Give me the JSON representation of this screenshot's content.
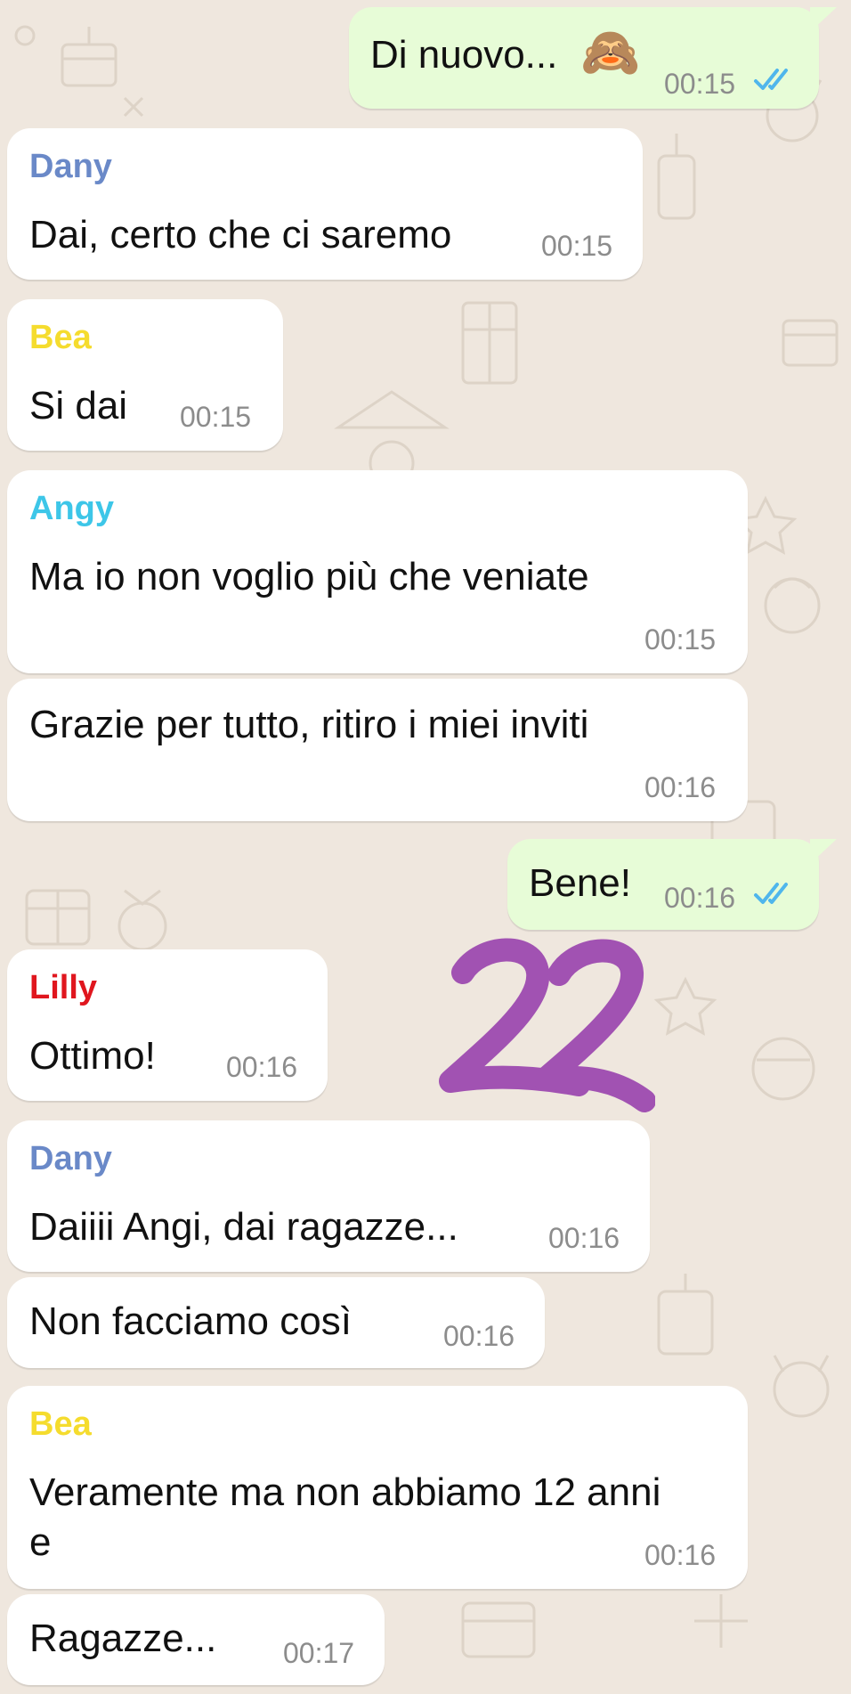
{
  "colors": {
    "background": "#efe7de",
    "outgoing_bubble": "#e7fcd7",
    "incoming_bubble": "#ffffff",
    "read_ticks": "#4fb6ec",
    "timestamp": "#8c8c8c",
    "annotation": "#a152b2"
  },
  "senders": {
    "dany": {
      "name": "Dany",
      "color": "#6a89c8"
    },
    "bea": {
      "name": "Bea",
      "color": "#f5dc2e"
    },
    "angy": {
      "name": "Angy",
      "color": "#3dc6e8"
    },
    "lilly": {
      "name": "Lilly",
      "color": "#e0161e"
    }
  },
  "messages": [
    {
      "direction": "outgoing",
      "text": "Di nuovo...",
      "emoji": "🙈",
      "emoji_name": "see-no-evil-monkey",
      "time": "00:15",
      "status": "read"
    },
    {
      "direction": "incoming",
      "sender": "Dany",
      "text": "Dai, certo che ci saremo",
      "time": "00:15"
    },
    {
      "direction": "incoming",
      "sender": "Bea",
      "text": "Si dai",
      "time": "00:15"
    },
    {
      "direction": "incoming",
      "sender": "Angy",
      "text": "Ma io non voglio più che veniate",
      "time": "00:15"
    },
    {
      "direction": "incoming",
      "text": "Grazie per tutto, ritiro i miei inviti",
      "time": "00:16"
    },
    {
      "direction": "outgoing",
      "text": "Bene!",
      "time": "00:16",
      "status": "read"
    },
    {
      "direction": "incoming",
      "sender": "Lilly",
      "text": "Ottimo!",
      "time": "00:16"
    },
    {
      "direction": "incoming",
      "sender": "Dany",
      "text": "Daiiii Angi, dai ragazze...",
      "time": "00:16"
    },
    {
      "direction": "incoming",
      "text": "Non facciamo così",
      "time": "00:16"
    },
    {
      "direction": "incoming",
      "sender": "Bea",
      "text_lines": [
        "Veramente ma non abbiamo 12 anni",
        "e"
      ],
      "time": "00:16"
    },
    {
      "direction": "incoming",
      "text": "Ragazze...",
      "time": "00:17"
    }
  ],
  "annotation": {
    "text": "22"
  }
}
